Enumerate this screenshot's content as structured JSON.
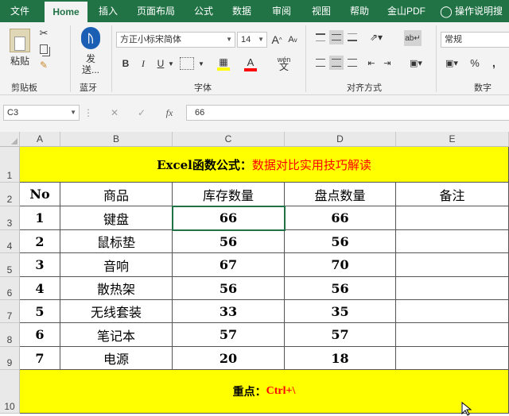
{
  "tabs": [
    "文件",
    "Home",
    "插入",
    "页面布局",
    "公式",
    "数据",
    "审阅",
    "视图",
    "帮助",
    "金山PDF",
    "操作说明搜"
  ],
  "ribbon": {
    "clipboard": {
      "paste": "粘贴",
      "label": "剪贴板"
    },
    "bluetooth": {
      "send1": "发",
      "send2": "送...",
      "label": "蓝牙"
    },
    "font": {
      "name": "方正小标宋简体",
      "size": "14",
      "bigger": "A",
      "smaller": "A",
      "bold": "B",
      "italic": "I",
      "underline": "U",
      "wen": "wén",
      "label": "字体"
    },
    "align": {
      "label": "对齐方式"
    },
    "number": {
      "format": "常规",
      "percent": "%",
      "comma": ",",
      "label": "数字"
    }
  },
  "formula_bar": {
    "cell_ref": "C3",
    "cancel": "✕",
    "confirm": "✓",
    "fx": "fx",
    "value": "66"
  },
  "columns": [
    "A",
    "B",
    "C",
    "D",
    "E"
  ],
  "rows": [
    "1",
    "2",
    "3",
    "4",
    "5",
    "6",
    "7",
    "8",
    "9",
    "10"
  ],
  "sheet": {
    "title_black": "Excel函数公式：",
    "title_red": "数据对比实用技巧解读",
    "headers": [
      "No",
      "商品",
      "库存数量",
      "盘点数量",
      "备注"
    ],
    "data": [
      [
        "1",
        "键盘",
        "66",
        "66",
        ""
      ],
      [
        "2",
        "鼠标垫",
        "56",
        "56",
        ""
      ],
      [
        "3",
        "音响",
        "67",
        "70",
        ""
      ],
      [
        "4",
        "散热架",
        "56",
        "56",
        ""
      ],
      [
        "5",
        "无线套装",
        "33",
        "35",
        ""
      ],
      [
        "6",
        "笔记本",
        "57",
        "57",
        ""
      ],
      [
        "7",
        "电源",
        "20",
        "18",
        ""
      ]
    ],
    "footer_black": "重点：",
    "footer_red": "Ctrl+\\"
  },
  "colors": {
    "excel_green": "#217346",
    "highlight": "#ffff00",
    "accent_red": "#ff0000"
  }
}
